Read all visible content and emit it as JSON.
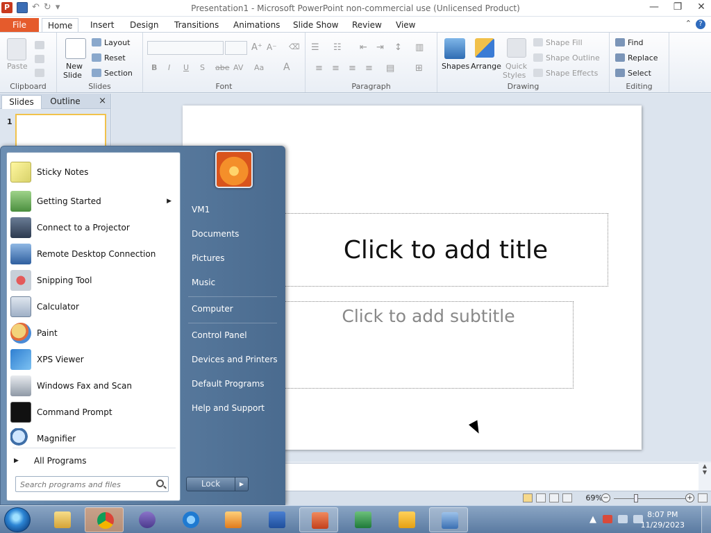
{
  "window": {
    "title": "Presentation1 - Microsoft PowerPoint non-commercial use (Unlicensed Product)",
    "app_icon": "P",
    "controls": [
      "minimize",
      "restore",
      "close"
    ]
  },
  "tabs": [
    "File",
    "Home",
    "Insert",
    "Design",
    "Transitions",
    "Animations",
    "Slide Show",
    "Review",
    "View"
  ],
  "ribbon": {
    "clipboard": {
      "paste": "Paste",
      "label": "Clipboard"
    },
    "slides": {
      "new_slide": "New",
      "new_slide2": "Slide",
      "layout": "Layout",
      "reset": "Reset",
      "section": "Section",
      "label": "Slides"
    },
    "font": {
      "label": "Font",
      "buttons": [
        "B",
        "I",
        "U",
        "S",
        "abe",
        "AV",
        "Aa",
        "A"
      ]
    },
    "paragraph": {
      "label": "Paragraph"
    },
    "drawing": {
      "shapes": "Shapes",
      "arrange": "Arrange",
      "quick": "Quick",
      "styles": "Styles",
      "shape_fill": "Shape Fill",
      "shape_outline": "Shape Outline",
      "shape_effects": "Shape Effects",
      "label": "Drawing"
    },
    "editing": {
      "find": "Find",
      "replace": "Replace",
      "select": "Select",
      "label": "Editing"
    }
  },
  "left_pane": {
    "tab_slides": "Slides",
    "tab_outline": "Outline",
    "close": "×",
    "slide_number": "1"
  },
  "slide": {
    "title_placeholder": "Click to add title",
    "subtitle_placeholder": "Click to add subtitle"
  },
  "status": {
    "zoom": "69%"
  },
  "start_menu": {
    "programs": [
      {
        "label": "Sticky Notes",
        "icon": "sticky-notes-icon",
        "submenu": false
      },
      {
        "label": "Getting Started",
        "icon": "getting-started-icon",
        "submenu": true
      },
      {
        "label": "Connect to a Projector",
        "icon": "projector-icon",
        "submenu": false
      },
      {
        "label": "Remote Desktop Connection",
        "icon": "remote-desktop-icon",
        "submenu": false
      },
      {
        "label": "Snipping Tool",
        "icon": "scissors-icon",
        "submenu": false
      },
      {
        "label": "Calculator",
        "icon": "calculator-icon",
        "submenu": false
      },
      {
        "label": "Paint",
        "icon": "paint-palette-icon",
        "submenu": false
      },
      {
        "label": "XPS Viewer",
        "icon": "xps-viewer-icon",
        "submenu": false
      },
      {
        "label": "Windows Fax and Scan",
        "icon": "fax-icon",
        "submenu": false
      },
      {
        "label": "Command Prompt",
        "icon": "command-prompt-icon",
        "submenu": false
      },
      {
        "label": "Magnifier",
        "icon": "magnifier-icon",
        "submenu": false
      }
    ],
    "all_programs": "All Programs",
    "search_placeholder": "Search programs and files",
    "right_links": [
      "VM1",
      "Documents",
      "Pictures",
      "Music",
      "Computer",
      "Control Panel",
      "Devices and Printers",
      "Default Programs",
      "Help and Support"
    ],
    "lock": "Lock"
  },
  "taskbar": {
    "apps": [
      "explorer-icon",
      "chrome-icon",
      "visual-studio-icon",
      "internet-explorer-icon",
      "media-player-icon",
      "word-icon",
      "powerpoint-icon",
      "excel-icon",
      "outlook-icon",
      "remote-app-icon"
    ],
    "time": "8:07 PM",
    "date": "11/29/2023"
  }
}
